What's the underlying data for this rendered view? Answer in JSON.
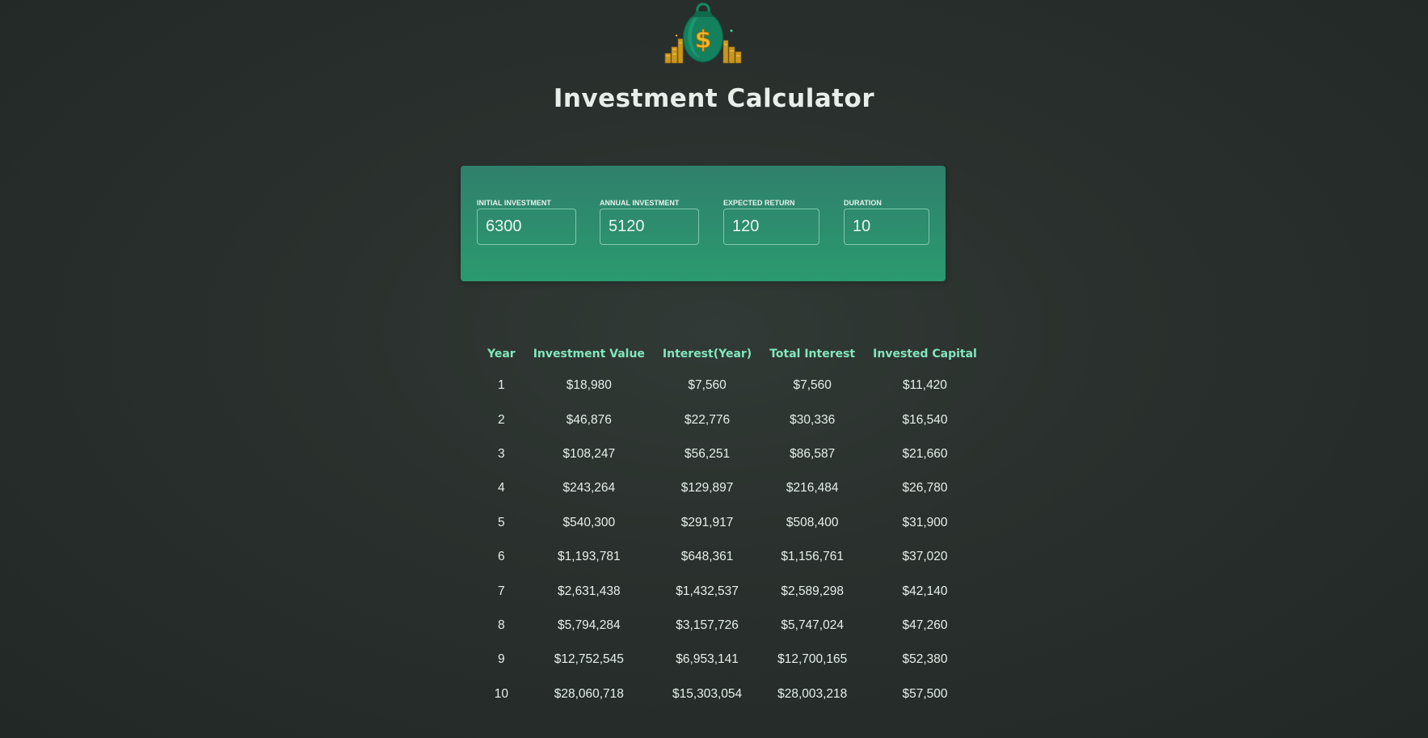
{
  "header": {
    "logo": "money-bag-dollar-icon",
    "title": "Investment Calculator"
  },
  "inputs": {
    "initial_investment": {
      "label": "Initial Investment",
      "value": "6300"
    },
    "annual_investment": {
      "label": "Annual Investment",
      "value": "5120"
    },
    "expected_return": {
      "label": "Expected Return",
      "value": "120"
    },
    "duration": {
      "label": "Duration",
      "value": "10"
    }
  },
  "results": {
    "headers": [
      "Year",
      "Investment Value",
      "Interest(Year)",
      "Total Interest",
      "Invested Capital"
    ],
    "rows": [
      [
        "1",
        "$18,980",
        "$7,560",
        "$7,560",
        "$11,420"
      ],
      [
        "2",
        "$46,876",
        "$22,776",
        "$30,336",
        "$16,540"
      ],
      [
        "3",
        "$108,247",
        "$56,251",
        "$86,587",
        "$21,660"
      ],
      [
        "4",
        "$243,264",
        "$129,897",
        "$216,484",
        "$26,780"
      ],
      [
        "5",
        "$540,300",
        "$291,917",
        "$508,400",
        "$31,900"
      ],
      [
        "6",
        "$1,193,781",
        "$648,361",
        "$1,156,761",
        "$37,020"
      ],
      [
        "7",
        "$2,631,438",
        "$1,432,537",
        "$2,589,298",
        "$42,140"
      ],
      [
        "8",
        "$5,794,284",
        "$3,157,726",
        "$5,747,024",
        "$47,260"
      ],
      [
        "9",
        "$12,752,545",
        "$6,953,141",
        "$12,700,165",
        "$52,380"
      ],
      [
        "10",
        "$28,060,718",
        "$15,303,054",
        "$28,003,218",
        "$57,500"
      ]
    ]
  },
  "colors": {
    "accent": "#83e6bd",
    "panel_top": "#307f6b",
    "panel_bottom": "#2b9a70",
    "background": "#2a302d"
  }
}
